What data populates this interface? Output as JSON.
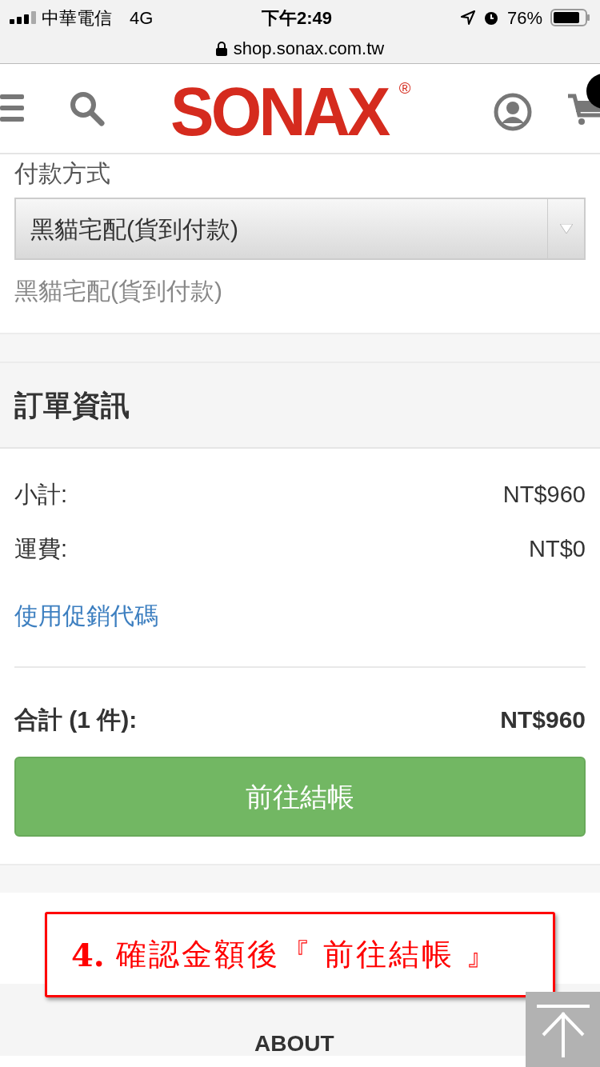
{
  "status_bar": {
    "carrier": "中華電信",
    "network": "4G",
    "time": "下午2:49",
    "battery": "76%",
    "url": "shop.sonax.com.tw"
  },
  "header": {
    "logo": "SONAX",
    "logo_mark": "®"
  },
  "payment": {
    "label": "付款方式",
    "select_value": "黑貓宅配(貨到付款)",
    "selected_text": "黑貓宅配(貨到付款)"
  },
  "order_info": {
    "title": "訂單資訊",
    "rows": [
      {
        "label": "小計:",
        "value": "NT$960"
      },
      {
        "label": "運費:",
        "value": "NT$0"
      }
    ],
    "promo_link": "使用促銷代碼",
    "total_label": "合計 (1 件):",
    "total_value": "NT$960",
    "checkout_button": "前往結帳"
  },
  "annotation": {
    "number": "4.",
    "text": "確認金額後『 前往結帳 』"
  },
  "footer": {
    "heading": "ABOUT"
  }
}
